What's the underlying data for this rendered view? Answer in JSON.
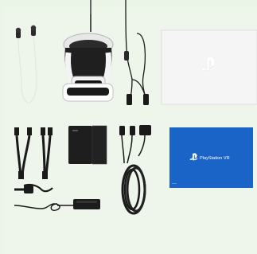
{
  "scene": {
    "background_color": "#ebf5e7",
    "items": [
      {
        "name": "earbuds",
        "icon": "earbuds-icon"
      },
      {
        "name": "vr-headset",
        "icon": "vr-headset-icon"
      },
      {
        "name": "headset-cable",
        "icon": "cable-icon"
      },
      {
        "name": "processor-unit",
        "icon": "processor-box-icon"
      },
      {
        "name": "hdmi-usb-cables",
        "icon": "hdmi-cable-icon"
      },
      {
        "name": "stand",
        "icon": "stand-icon"
      },
      {
        "name": "long-cable",
        "icon": "coiled-cable-icon"
      },
      {
        "name": "power-adapter",
        "icon": "power-adapter-icon"
      },
      {
        "name": "instruction-manual",
        "icon": "manual-icon"
      }
    ],
    "manual": {
      "brand_text": "PlayStation VR",
      "color": "#1b64c7"
    },
    "processor_logo_color": "#ffffff"
  }
}
